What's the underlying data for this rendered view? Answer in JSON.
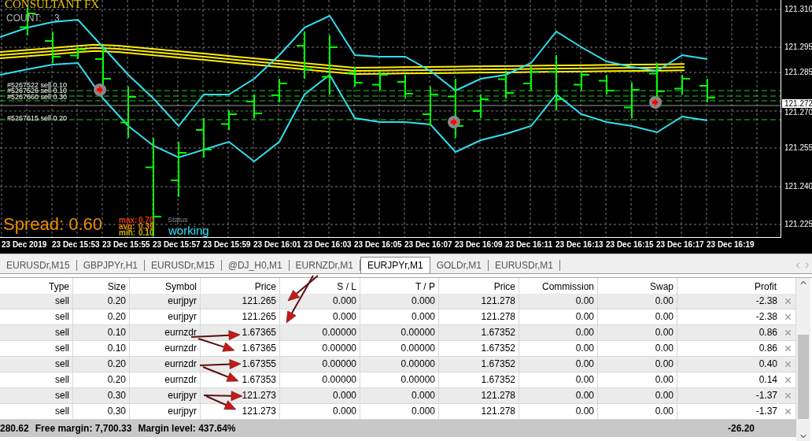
{
  "chart": {
    "title": "CONSULTANT FX",
    "count_label": "COUNT:",
    "count": "3",
    "orders": [
      {
        "label": "#5267522 sell 0.10"
      },
      {
        "label": "#5267526 sell 0.10"
      },
      {
        "label": "#5267660 sell 0.30"
      },
      {
        "label": "#5267615 sell 0.20"
      }
    ],
    "spread": {
      "label": "Spread: 0.60",
      "stats": [
        {
          "name": "max:",
          "value": "0.70",
          "color": "#e8380c"
        },
        {
          "name": "avg:",
          "value": "0.39",
          "color": "#f08c00"
        },
        {
          "name": "min:",
          "value": "0.10",
          "color": "#c8b400"
        }
      ]
    },
    "status": {
      "label": "Status",
      "value": "working"
    },
    "price_axis": [
      "121.310",
      "121.295",
      "121.285",
      "121.270",
      "121.255",
      "121.240",
      "121.225"
    ],
    "current_price": "121.272",
    "time_axis": [
      "23 Dec 2019",
      "23 Dec 15:53",
      "23 Dec 15:55",
      "23 Dec 15:57",
      "23 Dec 15:59",
      "23 Dec 16:01",
      "23 Dec 16:03",
      "23 Dec 16:05",
      "23 Dec 16:07",
      "23 Dec 16:09",
      "23 Dec 16:11",
      "23 Dec 16:13",
      "23 Dec 16:15",
      "23 Dec 16:17",
      "23 Dec 16:19"
    ]
  },
  "tabs": [
    {
      "label": "EURUSDr,M15",
      "selected": false
    },
    {
      "label": "GBPJPYr,H1",
      "selected": false
    },
    {
      "label": "EURUSDr,M15",
      "selected": false
    },
    {
      "label": "@DJ_H0,M1",
      "selected": false
    },
    {
      "label": "EURNZDr,M1",
      "selected": false
    },
    {
      "label": "EURJPYr,M1",
      "selected": true
    },
    {
      "label": "GOLDr,M1",
      "selected": false
    },
    {
      "label": "EURUSDr,M1",
      "selected": false
    }
  ],
  "table": {
    "columns": [
      "Type",
      "Size",
      "Symbol",
      "Price",
      "S / L",
      "T / P",
      "Price",
      "Commission",
      "Swap",
      "Profit"
    ],
    "rows": [
      [
        "sell",
        "0.20",
        "eurjpyr",
        "121.265",
        "0.000",
        "0.000",
        "121.278",
        "0.00",
        "0.00",
        "-2.38"
      ],
      [
        "sell",
        "0.20",
        "eurjpyr",
        "121.265",
        "0.000",
        "0.000",
        "121.278",
        "0.00",
        "0.00",
        "-2.38"
      ],
      [
        "sell",
        "0.10",
        "eurnzdr",
        "1.67365",
        "0.00000",
        "0.00000",
        "1.67352",
        "0.00",
        "0.00",
        "0.86"
      ],
      [
        "sell",
        "0.10",
        "eurnzdr",
        "1.67365",
        "0.00000",
        "0.00000",
        "1.67352",
        "0.00",
        "0.00",
        "0.86"
      ],
      [
        "sell",
        "0.20",
        "eurnzdr",
        "1.67355",
        "0.00000",
        "0.00000",
        "1.67352",
        "0.00",
        "0.00",
        "0.40"
      ],
      [
        "sell",
        "0.20",
        "eurnzdr",
        "1.67353",
        "0.00000",
        "0.00000",
        "1.67352",
        "0.00",
        "0.00",
        "0.14"
      ],
      [
        "sell",
        "0.30",
        "eurjpyr",
        "121.273",
        "0.000",
        "0.000",
        "121.278",
        "0.00",
        "0.00",
        "-1.37"
      ],
      [
        "sell",
        "0.30",
        "eurjpyr",
        "121.273",
        "0.000",
        "0.000",
        "121.278",
        "0.00",
        "0.00",
        "-1.37"
      ]
    ]
  },
  "status_bar": {
    "items": [
      "280.62",
      "Free margin: 7,700.33",
      "Margin level: 437.64%"
    ],
    "total": "-26.20"
  }
}
